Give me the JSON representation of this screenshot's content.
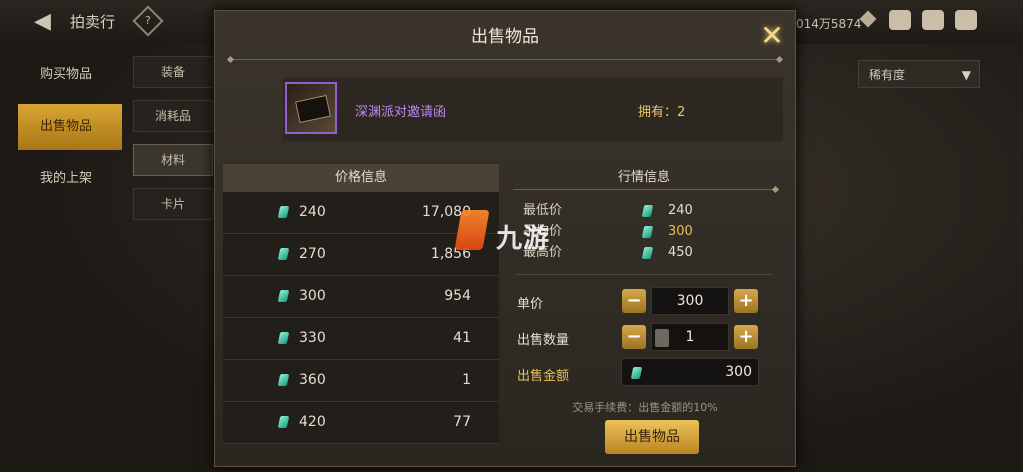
{
  "topbar": {
    "title": "拍卖行",
    "back_icon": "back-arrow-icon",
    "help_icon": "help-icon",
    "currency_text": "014万5874",
    "accent": "#d9a634"
  },
  "left_menu": {
    "items": [
      {
        "label": "购买物品",
        "active": false
      },
      {
        "label": "出售物品",
        "active": true
      },
      {
        "label": "我的上架",
        "active": false
      }
    ]
  },
  "sub_menu": {
    "items": [
      {
        "label": "装备",
        "active": false
      },
      {
        "label": "消耗品",
        "active": false
      },
      {
        "label": "材料",
        "active": true
      },
      {
        "label": "卡片",
        "active": false
      }
    ]
  },
  "filter": {
    "selected": "稀有度"
  },
  "dialog": {
    "title": "出售物品",
    "item": {
      "name": "深渊派对邀请函",
      "owned": "拥有：2"
    },
    "price_info": {
      "header": "价格信息",
      "rows": [
        {
          "price": "240",
          "qty": "17,080"
        },
        {
          "price": "270",
          "qty": "1,856"
        },
        {
          "price": "300",
          "qty": "954"
        },
        {
          "price": "330",
          "qty": "41"
        },
        {
          "price": "360",
          "qty": "1"
        },
        {
          "price": "420",
          "qty": "77"
        }
      ]
    },
    "market_info": {
      "header": "行情信息",
      "rows": [
        {
          "label": "最低价",
          "value": "240",
          "highlight": false
        },
        {
          "label": "平均价",
          "value": "300",
          "highlight": true
        },
        {
          "label": "最高价",
          "value": "450",
          "highlight": false
        }
      ]
    },
    "form": {
      "unit_price_label": "单价",
      "unit_price": "300",
      "quantity_label": "出售数量",
      "quantity": "1",
      "total_label": "出售金额",
      "total": "300",
      "minus": "−",
      "plus": "+"
    },
    "fee_text": "交易手续费：出售金额的10%",
    "sell_button": "出售物品"
  },
  "watermark": {
    "text": "九游"
  }
}
